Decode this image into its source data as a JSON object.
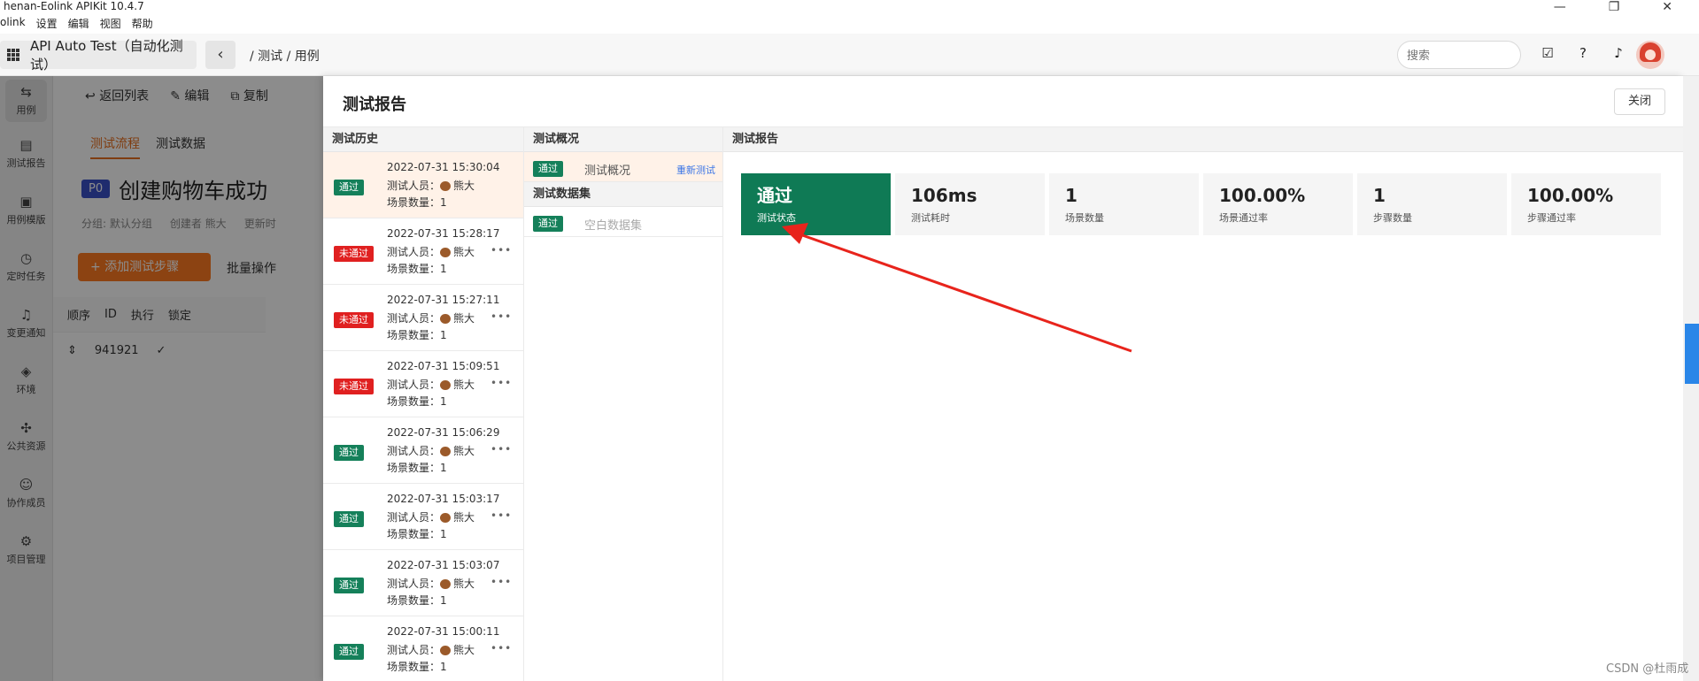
{
  "window": {
    "title": "henan-Eolink APIKit 10.4.7",
    "menu": [
      "olink",
      "设置",
      "编辑",
      "视图",
      "帮助"
    ],
    "minimize_icon": "minimize-icon",
    "maximize_icon": "restore-icon",
    "close_icon": "close-icon"
  },
  "topnav": {
    "project": "API Auto Test（自动化测试）",
    "back": "‹",
    "breadcrumb": "/ 测试 / 用例",
    "search_placeholder": "搜索"
  },
  "sidebar": {
    "items": [
      {
        "label": "用例",
        "icon": "swap-icon"
      },
      {
        "label": "测试报告",
        "icon": "report-icon"
      },
      {
        "label": "用例模版",
        "icon": "template-icon"
      },
      {
        "label": "定时任务",
        "icon": "clock-icon"
      },
      {
        "label": "变更通知",
        "icon": "bell-icon"
      },
      {
        "label": "环境",
        "icon": "environment-icon"
      },
      {
        "label": "公共资源",
        "icon": "puzzle-icon"
      },
      {
        "label": "协作成员",
        "icon": "user-icon"
      },
      {
        "label": "项目管理",
        "icon": "gear-icon"
      }
    ]
  },
  "background_page": {
    "toolbar": [
      "返回列表",
      "编辑",
      "复制"
    ],
    "tabs": [
      "测试流程",
      "测试数据"
    ],
    "priority": "P0",
    "title": "创建购物车成功",
    "meta_group": "分组: 默认分组",
    "meta_creator": "创建者 熊大",
    "meta_updated": "更新时",
    "add_step": "+ 添加测试步骤",
    "batch": "批量操作",
    "table_headers": [
      "顺序",
      "ID",
      "执行",
      "锁定"
    ],
    "row_id": "941921"
  },
  "drawer": {
    "title": "测试报告",
    "close": "关闭",
    "history_header": "测试历史",
    "summary_header": "测试概况",
    "report_header": "测试报告",
    "history": [
      {
        "time": "2022-07-31 15:30:04",
        "status": "通过",
        "tester": "测试人员：",
        "name": "熊大",
        "scenes": "场景数量：1"
      },
      {
        "time": "2022-07-31 15:28:17",
        "status": "未通过",
        "tester": "测试人员：",
        "name": "熊大",
        "scenes": "场景数量：1"
      },
      {
        "time": "2022-07-31 15:27:11",
        "status": "未通过",
        "tester": "测试人员：",
        "name": "熊大",
        "scenes": "场景数量：1"
      },
      {
        "time": "2022-07-31 15:09:51",
        "status": "未通过",
        "tester": "测试人员：",
        "name": "熊大",
        "scenes": "场景数量：1"
      },
      {
        "time": "2022-07-31 15:06:29",
        "status": "通过",
        "tester": "测试人员：",
        "name": "熊大",
        "scenes": "场景数量：1"
      },
      {
        "time": "2022-07-31 15:03:17",
        "status": "通过",
        "tester": "测试人员：",
        "name": "熊大",
        "scenes": "场景数量：1"
      },
      {
        "time": "2022-07-31 15:03:07",
        "status": "通过",
        "tester": "测试人员：",
        "name": "熊大",
        "scenes": "场景数量：1"
      },
      {
        "time": "2022-07-31 15:00:11",
        "status": "通过",
        "tester": "测试人员：",
        "name": "熊大",
        "scenes": "场景数量：1"
      }
    ],
    "summary": {
      "overview_status": "通过",
      "overview_label": "测试概况",
      "rerun": "重新测试",
      "dataset_header": "测试数据集",
      "dataset_status": "通过",
      "dataset_label": "空白数据集"
    },
    "stats": [
      {
        "value": "通过",
        "label": "测试状态"
      },
      {
        "value": "106ms",
        "label": "测试耗时"
      },
      {
        "value": "1",
        "label": "场景数量"
      },
      {
        "value": "100.00%",
        "label": "场景通过率"
      },
      {
        "value": "1",
        "label": "步骤数量"
      },
      {
        "value": "100.00%",
        "label": "步骤通过率"
      }
    ]
  },
  "watermark": "CSDN @杜雨成",
  "colors": {
    "pass": "#15805a",
    "fail": "#e02020",
    "accent": "#ff7a22",
    "arrow": "#e8241c"
  }
}
